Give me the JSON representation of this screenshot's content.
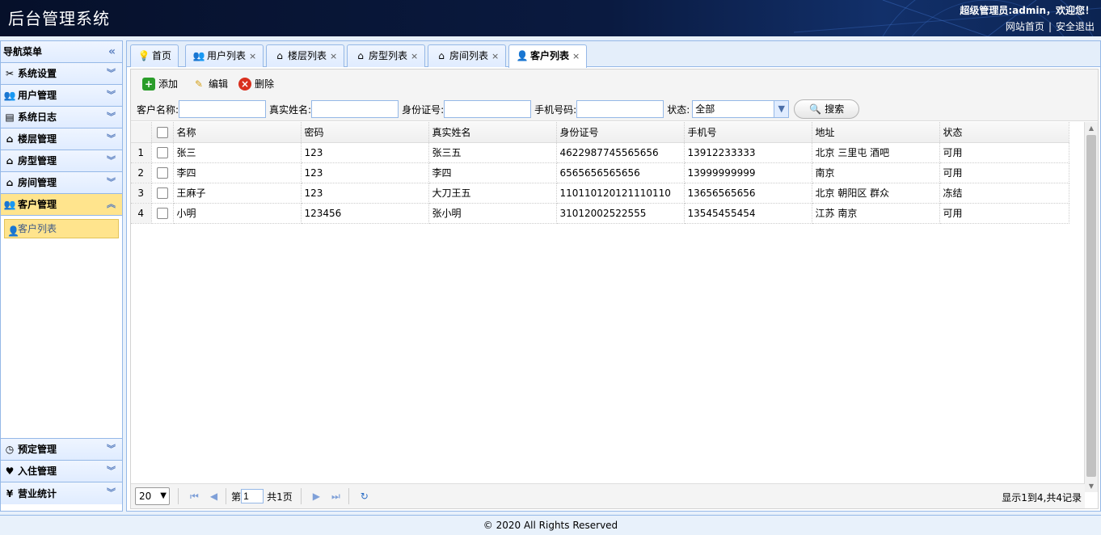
{
  "header": {
    "title": "后台管理系统",
    "welcome": "超级管理员:admin，欢迎您！",
    "home_link": "网站首页",
    "separator": "|",
    "logout_link": "安全退出"
  },
  "sidebar": {
    "title": "导航菜单",
    "collapse_icon": "double-chevron-left-icon",
    "groups": [
      {
        "label": "系统设置",
        "icon": "tools-icon"
      },
      {
        "label": "用户管理",
        "icon": "users-icon"
      },
      {
        "label": "系统日志",
        "icon": "log-icon"
      },
      {
        "label": "楼层管理",
        "icon": "building-icon"
      },
      {
        "label": "房型管理",
        "icon": "house-icon"
      },
      {
        "label": "房间管理",
        "icon": "house-icon"
      },
      {
        "label": "客户管理",
        "icon": "customer-icon",
        "active": true
      },
      {
        "label": "预定管理",
        "icon": "clock-icon"
      },
      {
        "label": "入住管理",
        "icon": "checkin-icon"
      },
      {
        "label": "营业统计",
        "icon": "yen-icon"
      }
    ],
    "active_sub_item": "客户列表"
  },
  "tabs": [
    {
      "label": "首页",
      "icon": "bulb-icon",
      "closable": false
    },
    {
      "label": "用户列表",
      "icon": "users-icon",
      "closable": true
    },
    {
      "label": "楼层列表",
      "icon": "building-icon",
      "closable": true
    },
    {
      "label": "房型列表",
      "icon": "house-icon",
      "closable": true
    },
    {
      "label": "房间列表",
      "icon": "house-icon",
      "closable": true
    },
    {
      "label": "客户列表",
      "icon": "customer-icon",
      "closable": true,
      "active": true
    }
  ],
  "tab_close": "×",
  "toolbar": {
    "add_label": "添加",
    "edit_label": "编辑",
    "delete_label": "删除"
  },
  "search": {
    "name_label": "客户名称:",
    "realname_label": "真实姓名:",
    "idcard_label": "身份证号:",
    "phone_label": "手机号码:",
    "status_label": "状态:",
    "status_value": "全部",
    "search_button": "搜索"
  },
  "grid": {
    "columns": [
      "名称",
      "密码",
      "真实姓名",
      "身份证号",
      "手机号",
      "地址",
      "状态"
    ],
    "rows": [
      {
        "n": "1",
        "name": "张三",
        "password": "123",
        "realname": "张三五",
        "idcard": "4622987745565656",
        "phone": "13912233333",
        "address": "北京 三里屯 酒吧",
        "status": "可用"
      },
      {
        "n": "2",
        "name": "李四",
        "password": "123",
        "realname": "李四",
        "idcard": "6565656565656",
        "phone": "13999999999",
        "address": "南京",
        "status": "可用"
      },
      {
        "n": "3",
        "name": "王麻子",
        "password": "123",
        "realname": "大刀王五",
        "idcard": "110110120121110110",
        "phone": "13656565656",
        "address": "北京 朝阳区 群众",
        "status": "冻结"
      },
      {
        "n": "4",
        "name": "小明",
        "password": "123456",
        "realname": "张小明",
        "idcard": "31012002522555",
        "phone": "13545455454",
        "address": "江苏 南京",
        "status": "可用"
      }
    ]
  },
  "pager": {
    "page_size": "20",
    "page_prefix": "第",
    "page_value": "1",
    "page_suffix": "共1页",
    "info": "显示1到4,共4记录"
  },
  "footer": "© 2020 All Rights Reserved",
  "colors": {
    "header_bg": "#0a1a40",
    "border": "#95b8e7",
    "active_yellow": "#ffe48d"
  }
}
